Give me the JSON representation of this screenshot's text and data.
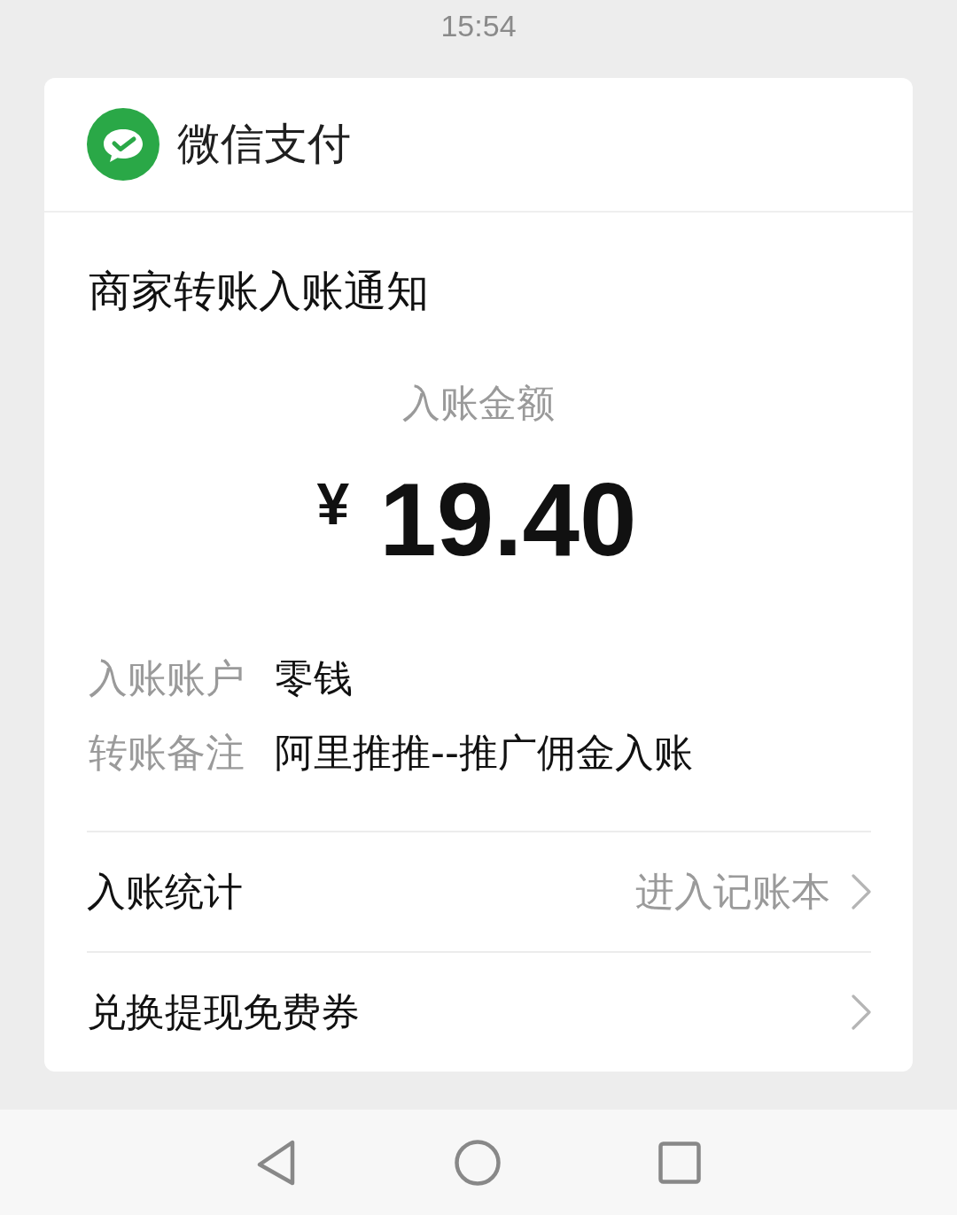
{
  "status_bar": {
    "time": "15:54"
  },
  "card": {
    "app": {
      "name": "微信支付"
    },
    "title": "商家转账入账通知",
    "amount": {
      "label": "入账金额",
      "currency": "¥",
      "value": "19.40"
    },
    "details": [
      {
        "label": "入账账户",
        "value": "零钱"
      },
      {
        "label": "转账备注",
        "value": "阿里推推--推广佣金入账"
      }
    ],
    "links": [
      {
        "label": "入账统计",
        "hint": "进入记账本"
      },
      {
        "label": "兑换提现免费券"
      }
    ]
  },
  "nav_bar": {
    "buttons": [
      {
        "kind": "back"
      },
      {
        "kind": "home"
      },
      {
        "kind": "recents"
      }
    ]
  }
}
